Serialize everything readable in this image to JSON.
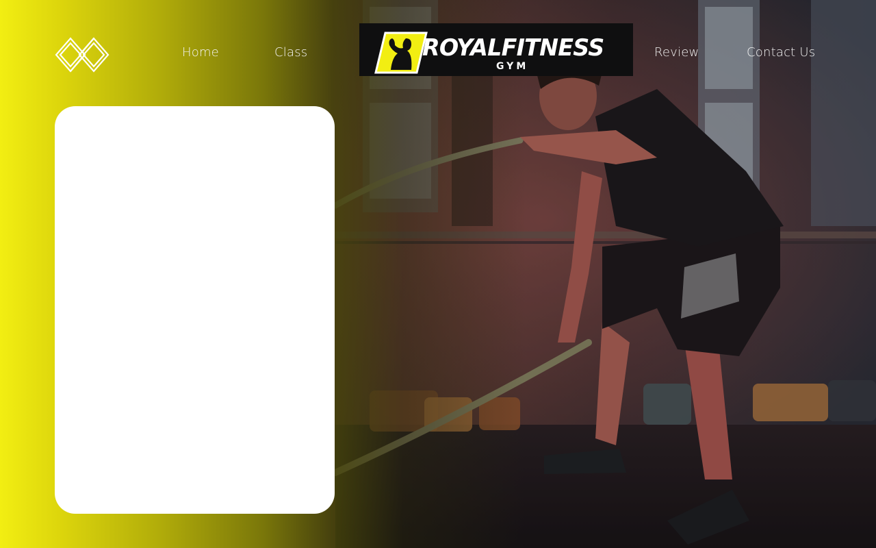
{
  "nav": {
    "left": [
      "Home",
      "Class"
    ],
    "right": [
      "Review",
      "Contact Us"
    ]
  },
  "brand": {
    "name": "ROYALFITNESS",
    "sub": "GYM"
  },
  "colors": {
    "accent": "#f2ee12",
    "brand_bg": "#0f0f10",
    "card": "#ffffff",
    "nav_text": "#f4f4f4"
  },
  "icons": {
    "site_logo": "interlocking-diamonds-logo-icon",
    "brand_emblem": "flexing-woman-emblem-icon"
  },
  "hero": {
    "description_only_visual": true
  },
  "main": {
    "card": {}
  }
}
